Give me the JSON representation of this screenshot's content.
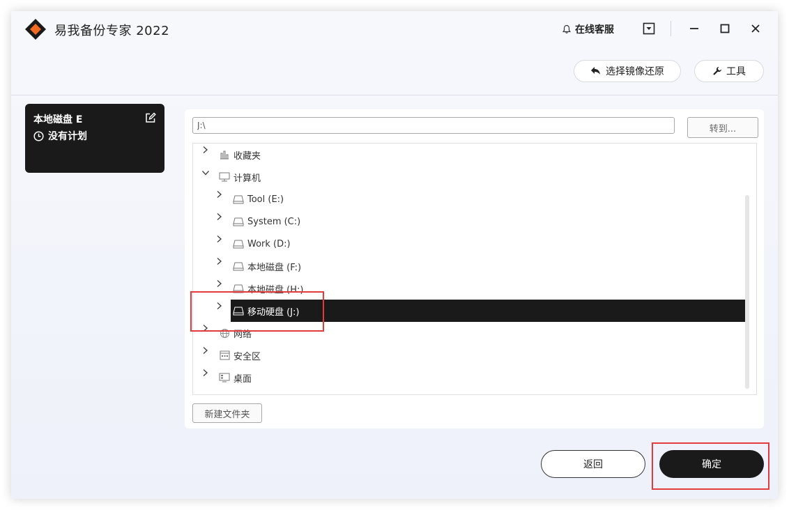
{
  "app": {
    "title": "易我备份专家 2022"
  },
  "titlebar": {
    "support_label": "在线客服"
  },
  "toolbar": {
    "restore_image_label": "选择镜像还原",
    "tools_label": "工具"
  },
  "plan": {
    "title": "本地磁盘 E",
    "status": "没有计划"
  },
  "browser": {
    "path_value": "J:\\",
    "goto_label": "转到...",
    "new_folder_label": "新建文件夹",
    "tree": [
      {
        "label": "收藏夹",
        "icon": "favorites-icon",
        "expanded": false,
        "level": 0
      },
      {
        "label": "计算机",
        "icon": "computer-icon",
        "expanded": true,
        "level": 0
      },
      {
        "label": "Tool (E:)",
        "icon": "drive-icon",
        "expanded": false,
        "level": 1
      },
      {
        "label": "System (C:)",
        "icon": "drive-icon",
        "expanded": false,
        "level": 1
      },
      {
        "label": "Work (D:)",
        "icon": "drive-icon",
        "expanded": false,
        "level": 1
      },
      {
        "label": "本地磁盘 (F:)",
        "icon": "drive-icon",
        "expanded": false,
        "level": 1
      },
      {
        "label": "本地磁盘 (H:)",
        "icon": "drive-icon",
        "expanded": false,
        "level": 1
      },
      {
        "label": "移动硬盘 (J:)",
        "icon": "drive-icon",
        "expanded": false,
        "level": 1,
        "selected": true
      },
      {
        "label": "网络",
        "icon": "network-icon",
        "expanded": false,
        "level": 0
      },
      {
        "label": "安全区",
        "icon": "secure-zone-icon",
        "expanded": false,
        "level": 0
      },
      {
        "label": "桌面",
        "icon": "desktop-icon",
        "expanded": false,
        "level": 0
      }
    ]
  },
  "footer": {
    "back_label": "返回",
    "confirm_label": "确定"
  },
  "colors": {
    "accent": "#1a1a1a",
    "logo_orange": "#f26b21",
    "highlight": "#e33b3b"
  }
}
